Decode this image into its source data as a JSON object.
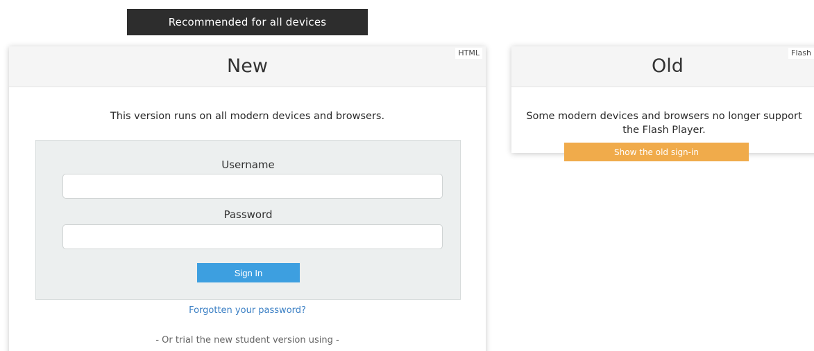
{
  "banner": {
    "recommended_label": "Recommended for all devices"
  },
  "new_panel": {
    "title": "New",
    "tag": "HTML",
    "description": "This version runs on all modern devices and browsers.",
    "username_label": "Username",
    "username_value": "",
    "password_label": "Password",
    "password_value": "",
    "signin_label": "Sign In",
    "forgot_link": "Forgotten your password?",
    "trial_text": "- Or trial the new student version using -"
  },
  "old_panel": {
    "title": "Old",
    "tag": "Flash",
    "description": "Some modern devices and browsers no longer support the Flash Player.",
    "button_label": "Show the old sign-in"
  },
  "colors": {
    "banner_bg": "#2d2d2d",
    "signin_button": "#3d9fe0",
    "old_signin_button": "#f0ab4b",
    "link": "#3a7fc4",
    "form_bg": "#ecefef"
  }
}
